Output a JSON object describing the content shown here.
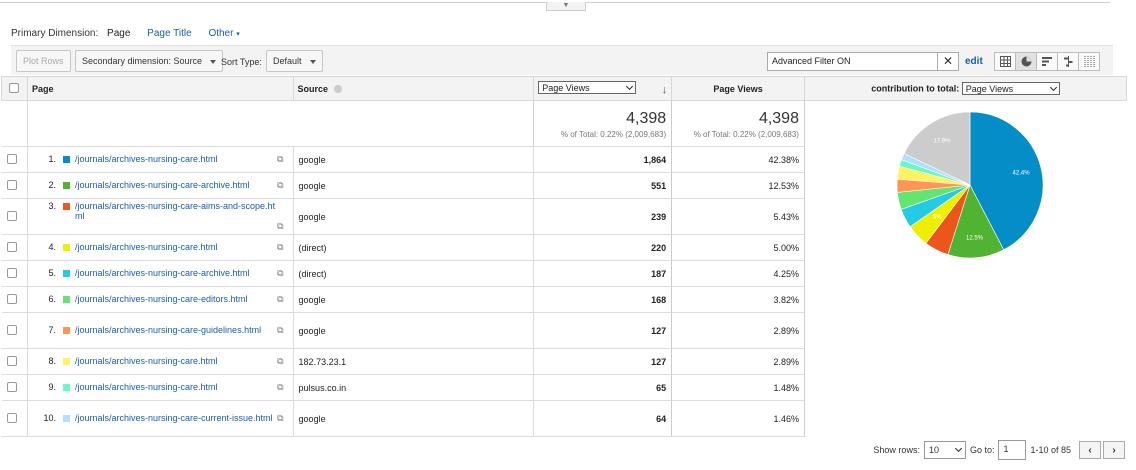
{
  "primary_dimension": {
    "label": "Primary Dimension:",
    "current": "Page",
    "options": [
      "Page Title",
      "Other"
    ]
  },
  "toolbar": {
    "plot_rows": "Plot Rows",
    "secondary_dimension": "Secondary dimension: Source",
    "sort_type_label": "Sort Type:",
    "sort_type_value": "Default",
    "filter_value": "Advanced Filter ON",
    "edit_label": "edit"
  },
  "table": {
    "headers": {
      "page": "Page",
      "source": "Source",
      "metric_select": "Page Views",
      "page_views": "Page Views",
      "contribution_label": "contribution to total:",
      "contribution_select": "Page Views"
    },
    "totals": {
      "col1_value": "4,398",
      "col1_sub": "% of Total: 0.22% (2,009,683)",
      "col2_value": "4,398",
      "col2_sub": "% of Total: 0.22% (2,009,683)"
    },
    "rows": [
      {
        "n": "1.",
        "page": "/journals/archives-nursing-care.html",
        "source": "google",
        "views": "1,864",
        "pct": "42.38%",
        "color": "#058dc7"
      },
      {
        "n": "2.",
        "page": "/journals/archives-nursing-care-archive.html",
        "source": "google",
        "views": "551",
        "pct": "12.53%",
        "color": "#50b432"
      },
      {
        "n": "3.",
        "page": "/journals/archives-nursing-care-aims-and-scope.html",
        "source": "google",
        "views": "239",
        "pct": "5.43%",
        "color": "#ed561b"
      },
      {
        "n": "4.",
        "page": "/journals/archives-nursing-care.html",
        "source": "(direct)",
        "views": "220",
        "pct": "5.00%",
        "color": "#edef00"
      },
      {
        "n": "5.",
        "page": "/journals/archives-nursing-care-archive.html",
        "source": "(direct)",
        "views": "187",
        "pct": "4.25%",
        "color": "#24cbe5"
      },
      {
        "n": "6.",
        "page": "/journals/archives-nursing-care-editors.html",
        "source": "google",
        "views": "168",
        "pct": "3.82%",
        "color": "#64e572"
      },
      {
        "n": "7.",
        "page": "/journals/archives-nursing-care-guidelines.html",
        "source": "google",
        "views": "127",
        "pct": "2.89%",
        "color": "#ff9655"
      },
      {
        "n": "8.",
        "page": "/journals/archives-nursing-care.html",
        "source": "182.73.23.1",
        "views": "127",
        "pct": "2.89%",
        "color": "#fff263"
      },
      {
        "n": "9.",
        "page": "/journals/archives-nursing-care.html",
        "source": "pulsus.co.in",
        "views": "65",
        "pct": "1.48%",
        "color": "#6af9c4"
      },
      {
        "n": "10.",
        "page": "/journals/archives-nursing-care-current-issue.html",
        "source": "google",
        "views": "64",
        "pct": "1.46%",
        "color": "#b2deff"
      }
    ]
  },
  "pie": {
    "other_share": 17.9,
    "other_color": "#cccccc",
    "labels": {
      "first": "42.4%",
      "second": "12.5%",
      "fourth": "5%",
      "other": "17.9%"
    }
  },
  "footer": {
    "show_rows_label": "Show rows:",
    "show_rows_value": "10",
    "goto_label": "Go to:",
    "goto_value": "1",
    "range": "1-10 of 85"
  }
}
